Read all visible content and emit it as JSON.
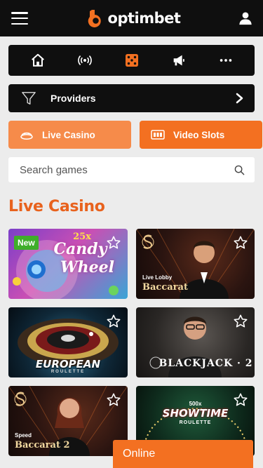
{
  "header": {
    "brand": "optimbet"
  },
  "categories": [
    {
      "name": "home",
      "icon": "home-icon"
    },
    {
      "name": "live",
      "icon": "broadcast-icon"
    },
    {
      "name": "casino",
      "icon": "dice-icon",
      "active": true
    },
    {
      "name": "promotions",
      "icon": "megaphone-icon"
    },
    {
      "name": "more",
      "icon": "more-dots-icon"
    }
  ],
  "providers": {
    "label": "Providers"
  },
  "tabs": [
    {
      "label": "Live Casino",
      "active": true
    },
    {
      "label": "Video Slots",
      "active": false
    }
  ],
  "search": {
    "placeholder": "Search games"
  },
  "section": {
    "title": "Live Casino"
  },
  "games": [
    {
      "badge": "New",
      "title_line1": "25x",
      "title_line2": "Candy",
      "title_line3": "Wheel"
    },
    {
      "subtitle": "Live Lobby",
      "title": "Baccarat"
    },
    {
      "title": "EUROPEAN",
      "subtitle": "ROULETTE"
    },
    {
      "title": "BLACKJACK · 2"
    },
    {
      "subtitle": "Speed",
      "title": "Baccarat 2"
    },
    {
      "title_line1": "500x",
      "title_line2": "SHOWTIME",
      "subtitle": "ROULETTE"
    }
  ],
  "chat": {
    "label": "Online"
  },
  "colors": {
    "accent": "#f37021",
    "accent_light": "#f68b4a",
    "dark": "#0f0f0f",
    "title": "#e8621d",
    "new_badge": "#3fae2a"
  }
}
